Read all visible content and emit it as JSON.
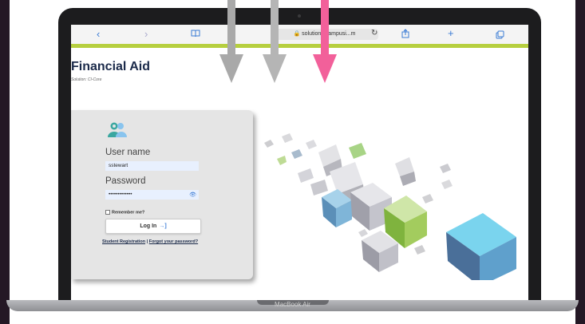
{
  "device": {
    "brand": "MacBook Air"
  },
  "browser": {
    "url": "solutions.campusi...m",
    "icons": [
      "back-icon",
      "forward-icon",
      "bookmarks-icon",
      "lock-icon",
      "reload-icon",
      "share-icon",
      "new-tab-icon",
      "tabs-icon"
    ]
  },
  "page": {
    "title": "Financial Aid",
    "subtitle": "Solution: CI-Core"
  },
  "login": {
    "username_label": "User name",
    "username_value": "sstewart",
    "password_label": "Password",
    "password_value": "•••••••••••••",
    "remember_label": "Remember me?",
    "login_button": "Log In",
    "student_registration": "Student Registration",
    "separator": "|",
    "forgot_password": "Forgot your password?"
  },
  "annotations": {
    "arrow_colors": [
      "#a9a9a9",
      "#b5b5b5",
      "#f2609a"
    ]
  },
  "colors": {
    "accent_green": "#b6cf3f",
    "title_navy": "#1b2a4a",
    "link_blue": "#3a7bd5"
  }
}
